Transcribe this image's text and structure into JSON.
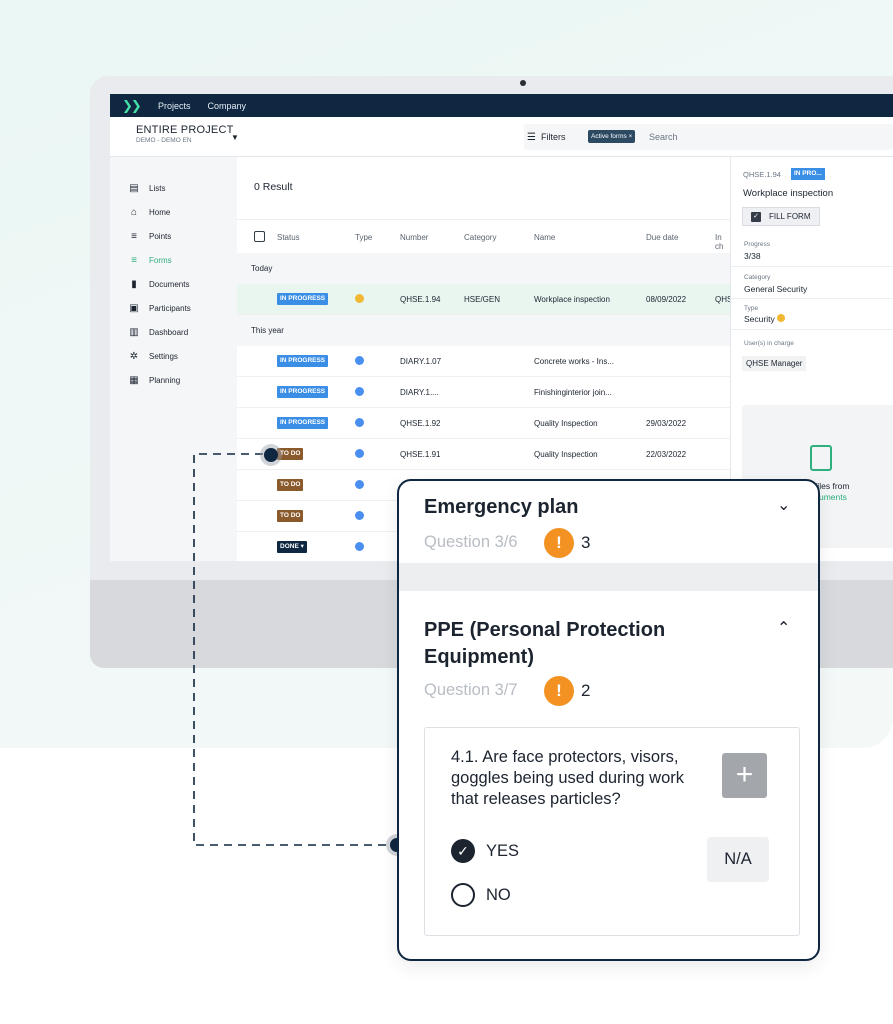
{
  "topbar": {
    "nav": [
      "Projects",
      "Company"
    ]
  },
  "project": {
    "name": "ENTIRE PROJECT",
    "sub": "DEMO - DEMO EN"
  },
  "toolbar": {
    "filters_label": "Filters",
    "chip_label": "Active forms ×",
    "search_placeholder": "Search"
  },
  "sidebar": {
    "items": [
      {
        "label": "Lists",
        "icon": "clipboard-icon"
      },
      {
        "label": "Home",
        "icon": "home-icon"
      },
      {
        "label": "Points",
        "icon": "list-icon"
      },
      {
        "label": "Forms",
        "icon": "forms-icon",
        "active": true
      },
      {
        "label": "Documents",
        "icon": "document-icon"
      },
      {
        "label": "Participants",
        "icon": "participants-icon"
      },
      {
        "label": "Dashboard",
        "icon": "dashboard-icon"
      },
      {
        "label": "Settings",
        "icon": "gear-icon"
      },
      {
        "label": "Planning",
        "icon": "planning-icon"
      }
    ]
  },
  "main": {
    "result": "0  Result",
    "columns": [
      "Status",
      "Type",
      "Number",
      "Category",
      "Name",
      "Due date",
      "In ch"
    ],
    "groups": {
      "today": "Today",
      "this_year": "This year"
    },
    "rows": [
      {
        "status": "IN PROGRESS",
        "number": "QHSE.1.94",
        "category": "HSE/GEN",
        "name": "Workplace inspection",
        "due": "08/09/2022",
        "incharge": "QHS"
      },
      {
        "status": "IN PROGRESS",
        "number": "DIARY.1.07",
        "category": "",
        "name": "Concrete works - Ins...",
        "due": "",
        "incharge": ""
      },
      {
        "status": "IN PROGRESS",
        "number": "DIARY.1....",
        "category": "",
        "name": "Finishinginterior join...",
        "due": "",
        "incharge": ""
      },
      {
        "status": "IN PROGRESS",
        "number": "QHSE.1.92",
        "category": "",
        "name": "Quality Inspection",
        "due": "29/03/2022",
        "incharge": ""
      },
      {
        "status": "TO DO",
        "number": "QHSE.1.91",
        "category": "",
        "name": "Quality Inspection",
        "due": "22/03/2022",
        "incharge": ""
      },
      {
        "status": "TO DO",
        "number": "",
        "category": "",
        "name": "",
        "due": "",
        "incharge": ""
      },
      {
        "status": "TO DO",
        "number": "",
        "category": "",
        "name": "",
        "due": "",
        "incharge": ""
      },
      {
        "status": "DONE ▾",
        "number": "",
        "category": "",
        "name": "",
        "due": "",
        "incharge": ""
      }
    ]
  },
  "detail": {
    "number": "QHSE.1.94",
    "badge": "IN PRO...",
    "title": "Workplace inspection",
    "fill_form": "FILL FORM",
    "progress_label": "Progress",
    "progress_value": "3/38",
    "category_label": "Category",
    "category_value": "General Security",
    "type_label": "Type",
    "type_value": "Security",
    "incharge_label": "User(s) in charge",
    "incharge_value": "QHSE Manager",
    "drop_text": "files from",
    "drop_link": "uments"
  },
  "card": {
    "section1": {
      "title": "Emergency plan",
      "question": "Question 3/6",
      "alerts": "3"
    },
    "section2": {
      "title": "PPE (Personal Protection Equipment)",
      "question": "Question 3/7",
      "alerts": "2"
    },
    "question_text": "4.1. Are face protectors, visors, goggles being used during work that releases particles?",
    "plus": "+",
    "options": {
      "yes": "YES",
      "no": "NO"
    },
    "selected": "YES",
    "na": "N/A"
  },
  "colors": {
    "navy": "#0f2740",
    "accent_green": "#2fae7e",
    "in_progress": "#3a8ee6",
    "to_do": "#8a5a2c",
    "done": "#0f2740",
    "alert_orange": "#f39223"
  }
}
